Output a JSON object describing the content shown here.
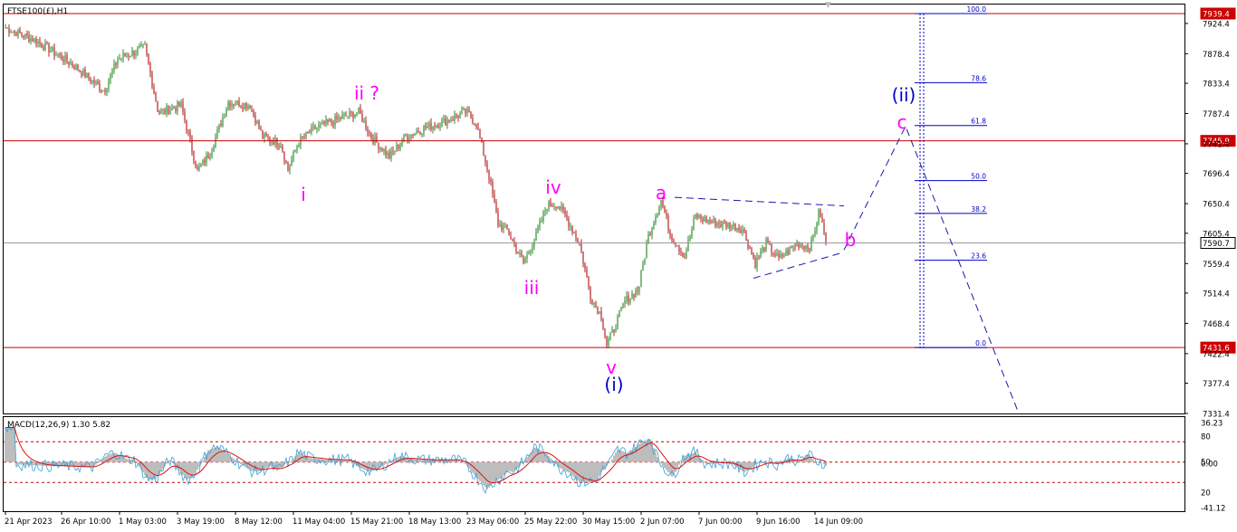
{
  "chart_data": [
    {
      "type": "candlestick",
      "title": "FTSE100(£),H1",
      "ylim": [
        7300,
        7950
      ],
      "y_ticks": [
        7924.4,
        7878.4,
        7833.4,
        7787.4,
        7741.4,
        7696.4,
        7650.4,
        7605.4,
        7559.4,
        7514.4,
        7468.4,
        7422.4,
        7377.4,
        7331.4
      ],
      "x_ticks": [
        "21 Apr 2023",
        "26 Apr 10:00",
        "1 May 03:00",
        "3 May 19:00",
        "8 May 12:00",
        "11 May 04:00",
        "15 May 21:00",
        "18 May 13:00",
        "23 May 06:00",
        "25 May 22:00",
        "30 May 15:00",
        "2 Jun 07:00",
        "7 Jun 00:00",
        "9 Jun 16:00",
        "14 Jun 09:00"
      ],
      "horizontal_levels": [
        {
          "label": "7939.4",
          "value": 7939.4,
          "color": "#cc0000"
        },
        {
          "label": "7745.9",
          "value": 7745.9,
          "color": "#cc0000"
        },
        {
          "label": "7431.6",
          "value": 7431.6,
          "color": "#cc0000"
        },
        {
          "label": "7590.7",
          "value": 7590.7,
          "color": "#9a9a9a"
        }
      ],
      "wave_labels": [
        {
          "text": "i",
          "color": "#ff00ff"
        },
        {
          "text": "ii ?",
          "color": "#ff00ff"
        },
        {
          "text": "iii",
          "color": "#ff00ff"
        },
        {
          "text": "iv",
          "color": "#ff00ff"
        },
        {
          "text": "v",
          "color": "#ff00ff"
        },
        {
          "text": "(i)",
          "color": "#0000cc"
        },
        {
          "text": "a",
          "color": "#ff00ff"
        },
        {
          "text": "b",
          "color": "#ff00ff"
        },
        {
          "text": "c",
          "color": "#ff00ff"
        },
        {
          "text": "(ii)",
          "color": "#0000cc"
        }
      ],
      "fibonacci": {
        "levels": [
          "100.0",
          "78.6",
          "61.8",
          "50.0",
          "38.2",
          "23.6",
          "0.0"
        ],
        "values": [
          7939.4,
          7834.4,
          7769.2,
          7685.5,
          7635.5,
          7564.4,
          7431.6
        ],
        "color": "#0000cc"
      }
    },
    {
      "type": "line",
      "title": "MACD(12,26,9) 1.30 5.82",
      "ylim": [
        -45,
        40
      ],
      "y_ticks": [
        "36.23",
        "80",
        "50",
        "0.00",
        "20",
        "-41.12"
      ],
      "levels": [
        20,
        0,
        -20
      ]
    }
  ],
  "colors": {
    "up": "#2e8b2e",
    "down": "#b22222",
    "level_line": "#cc0000",
    "fib": "#0000cc",
    "pattern": "#1a1aaa",
    "histogram": "#bdbdbd",
    "macd_main": "#3aa0d8",
    "macd_signal": "#dd1111"
  }
}
